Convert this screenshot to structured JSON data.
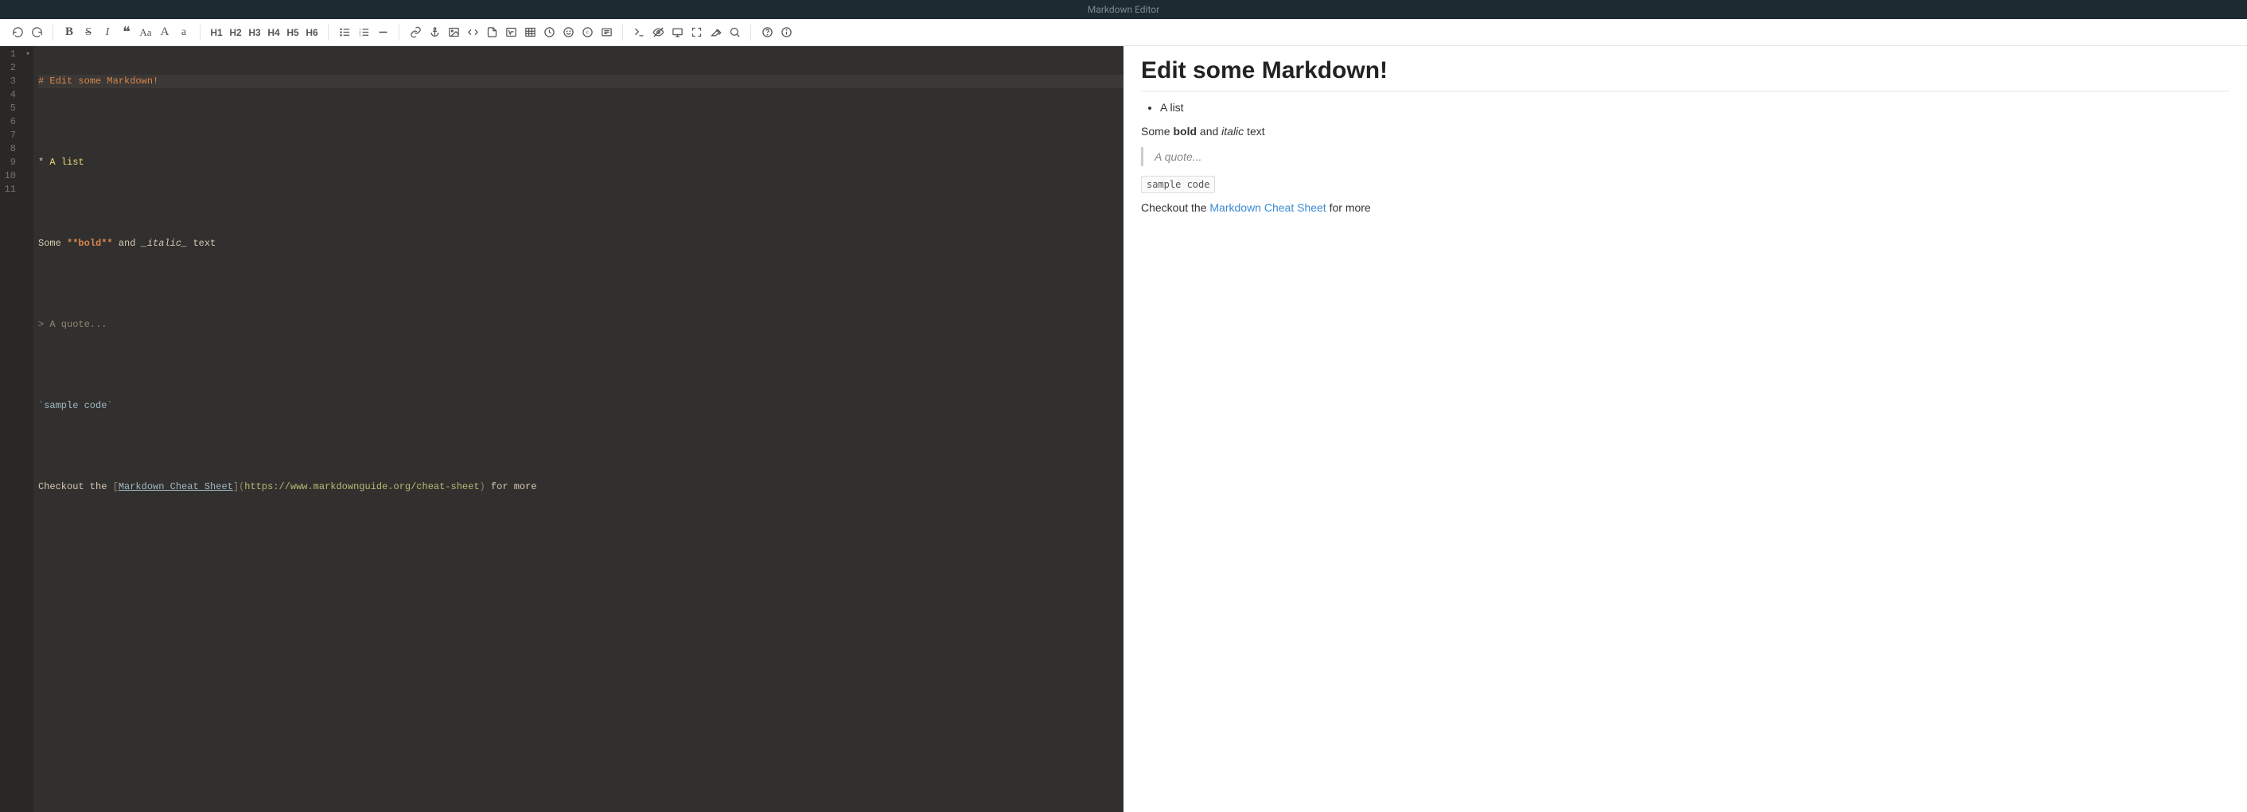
{
  "title": "Markdown Editor",
  "toolbar": {
    "headings": [
      "H1",
      "H2",
      "H3",
      "H4",
      "H5",
      "H6"
    ]
  },
  "editor": {
    "line_numbers": [
      "1",
      "2",
      "3",
      "4",
      "5",
      "6",
      "7",
      "8",
      "9",
      "10",
      "11"
    ],
    "active_line": 1,
    "lines": {
      "l1": {
        "hash": "#",
        "text": " Edit some Markdown!"
      },
      "l3": {
        "bullet": "*",
        "text": " A list"
      },
      "l5": {
        "pre": "Some ",
        "bold": "**bold**",
        "mid": " and ",
        "ital": "_italic_",
        "post": " text"
      },
      "l7": "> A quote...",
      "l9": "`sample code`",
      "l11": {
        "pre": "Checkout the ",
        "lb": "[",
        "linktext": "Markdown Cheat Sheet",
        "rb": "]",
        "lp": "(",
        "url": "https://www.markdownguide.org/cheat-sheet",
        "rp": ")",
        "post": " for more"
      }
    }
  },
  "preview": {
    "heading": "Edit some Markdown!",
    "list_item": "A list",
    "para1_pre": "Some ",
    "para1_bold": "bold",
    "para1_mid": " and ",
    "para1_ital": "italic",
    "para1_post": " text",
    "quote": "A quote...",
    "code": "sample code",
    "para2_pre": "Checkout the ",
    "para2_link": "Markdown Cheat Sheet",
    "para2_post": " for more"
  }
}
